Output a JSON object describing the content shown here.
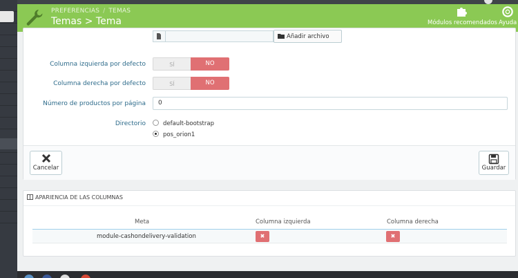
{
  "header": {
    "breadcrumb": [
      "PREFERENCIAS",
      "TEMAS"
    ],
    "title": "Temas > Tema",
    "buttons": [
      {
        "label": "Módulos recomendados",
        "icon": "puzzle-icon"
      },
      {
        "label": "Ayuda",
        "icon": "lifebuoy-icon"
      }
    ]
  },
  "form": {
    "file_button_label": "Añadir archivo",
    "fields": [
      {
        "label": "Columna izquierda por defecto",
        "yes": "SÍ",
        "no": "NO",
        "value": "NO"
      },
      {
        "label": "Columna derecha por defecto",
        "yes": "SÍ",
        "no": "NO",
        "value": "NO"
      }
    ],
    "products_per_page": {
      "label": "Número de productos por página",
      "value": "0"
    },
    "directory": {
      "label": "Directorio",
      "options": [
        {
          "label": "default-bootstrap",
          "checked": false
        },
        {
          "label": "pos_orion1",
          "checked": true
        }
      ]
    },
    "cancel_label": "Cancelar",
    "save_label": "Guardar"
  },
  "columns_panel": {
    "title": "APARIENCIA DE LAS COLUMNAS",
    "headers": [
      "Meta",
      "Columna izquierda",
      "Columna derecha"
    ],
    "rows": [
      {
        "meta": "module-cashondelivery-validation",
        "left": "x",
        "right": "x"
      }
    ]
  },
  "colors": {
    "header_green": "#8bc954",
    "toggle_no_red": "#e07073",
    "label_blue": "#2c6a8a"
  }
}
